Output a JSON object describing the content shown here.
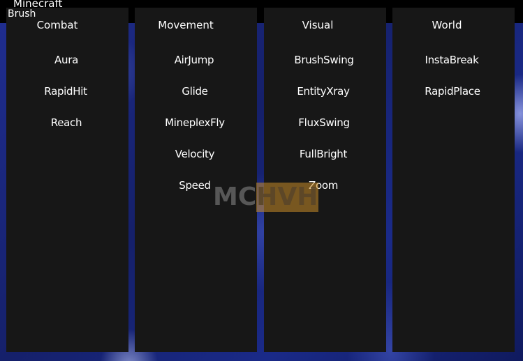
{
  "window": {
    "title": "Minecraft"
  },
  "client": {
    "name": "Brush"
  },
  "watermark": {
    "part1": "MC",
    "part2": "HVH"
  },
  "panels": [
    {
      "header": "Combat",
      "items": [
        "Aura",
        "RapidHit",
        "Reach"
      ]
    },
    {
      "header": "Movement",
      "items": [
        "AirJump",
        "Glide",
        "MineplexFly",
        "Velocity",
        "Speed"
      ]
    },
    {
      "header": "Visual",
      "items": [
        "BrushSwing",
        "EntityXray",
        "FluxSwing",
        "FullBright",
        "Zoom"
      ]
    },
    {
      "header": "World",
      "items": [
        "InstaBreak",
        "RapidPlace"
      ]
    }
  ]
}
